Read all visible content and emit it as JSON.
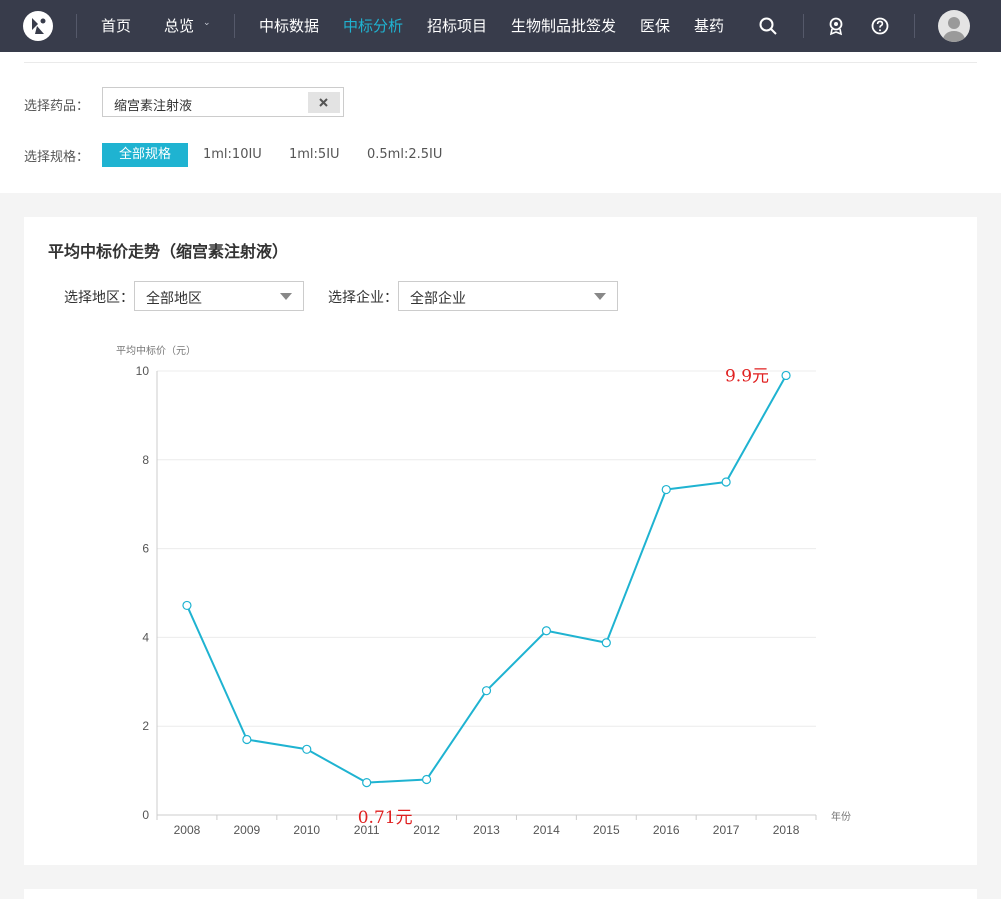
{
  "nav": {
    "items": [
      "首页",
      "总览",
      "中标数据",
      "中标分析",
      "招标项目",
      "生物制品批签发",
      "医保",
      "基药"
    ],
    "active_index": 3,
    "caret": "⌄"
  },
  "filters": {
    "drug_label": "选择药品：",
    "drug_value": "缩宫素注射液",
    "spec_label": "选择规格：",
    "specs": [
      "全部规格",
      "1ml:10IU",
      "1ml:5IU",
      "0.5ml:2.5IU"
    ]
  },
  "card": {
    "title": "平均中标价走势（缩宫素注射液）",
    "region_label": "选择地区：",
    "region_value": "全部地区",
    "company_label": "选择企业：",
    "company_value": "全部企业"
  },
  "colors": {
    "accent": "#1fb3d1",
    "annotation": "#e02020",
    "nav_bg": "#383c4b"
  },
  "chart_data": {
    "type": "line",
    "title": "",
    "xlabel": "年份",
    "ylabel": "平均中标价（元）",
    "x": [
      "2008",
      "2009",
      "2010",
      "2011",
      "2012",
      "2013",
      "2014",
      "2015",
      "2016",
      "2017",
      "2018"
    ],
    "series": [
      {
        "values": [
          4.72,
          1.7,
          1.48,
          0.73,
          0.8,
          2.8,
          4.15,
          3.88,
          7.33,
          7.5,
          9.9
        ]
      }
    ],
    "ylim": [
      0,
      10
    ],
    "yticks": [
      0,
      2,
      4,
      6,
      8,
      10
    ],
    "grid": true,
    "annotations": [
      {
        "text": "9.9元",
        "x": "2018",
        "y": 9.9
      },
      {
        "text": "0.71元",
        "x": "2012",
        "y": 0
      }
    ]
  }
}
